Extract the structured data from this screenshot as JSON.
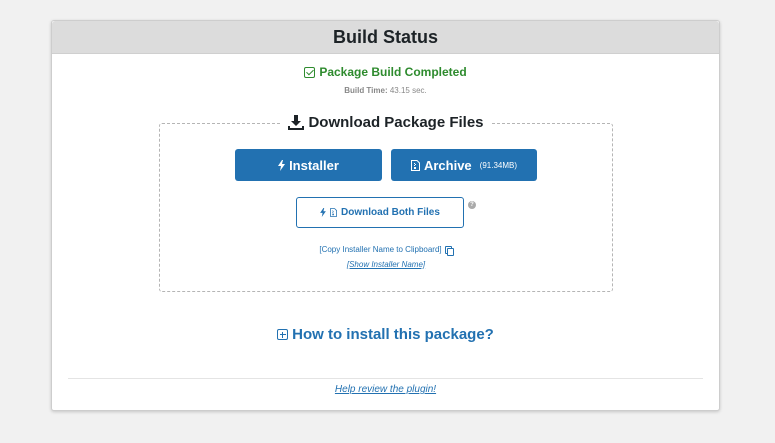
{
  "header": {
    "title": "Build Status"
  },
  "build": {
    "status": "Package Build Completed",
    "time_label": "Build Time:",
    "time_value": "43.15 sec."
  },
  "download": {
    "heading": "Download Package Files",
    "installer_label": "Installer",
    "archive_label": "Archive",
    "archive_size": "(91.34MB)",
    "both_label": "Download Both Files",
    "help_glyph": "?",
    "copy_installer_name": "[Copy Installer Name to Clipboard]",
    "show_installer_name": "[Show Installer Name]"
  },
  "how_to": {
    "label": "How to install this package?"
  },
  "footer": {
    "review_link": "Help review the plugin!"
  },
  "colors": {
    "accent": "#2271b1",
    "success": "#2e8b2e",
    "header_bg": "#dcdcdc",
    "page_bg": "#f1f1f1"
  },
  "icons": [
    "check-square-icon",
    "download-icon",
    "bolt-icon",
    "file-archive-icon",
    "help-icon",
    "copy-icon",
    "plus-square-icon"
  ]
}
